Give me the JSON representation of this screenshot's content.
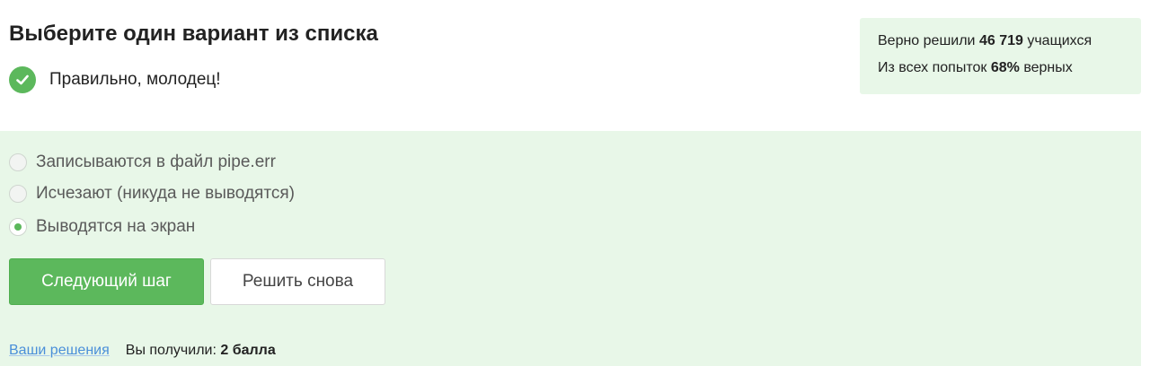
{
  "question": {
    "heading": "Выберите один вариант из списка",
    "feedback": "Правильно, молодец!"
  },
  "stats": {
    "solved_prefix": "Верно решили",
    "solved_count": "46 719",
    "solved_suffix": "учащихся",
    "attempts_prefix": "Из всех попыток",
    "attempts_percent": "68%",
    "attempts_suffix": "верных"
  },
  "options": [
    {
      "label": "Записываются в файл pipe.err",
      "selected": false
    },
    {
      "label": "Исчезают (никуда не выводятся)",
      "selected": false
    },
    {
      "label": "Выводятся на экран",
      "selected": true
    }
  ],
  "buttons": {
    "next": "Следующий шаг",
    "retry": "Решить снова"
  },
  "footer": {
    "solutions_link": "Ваши решения",
    "score_prefix": "Вы получили:",
    "score_value": "2 балла"
  },
  "colors": {
    "accent": "#5cb85c",
    "panel_bg": "#e8f7e8",
    "link": "#4a8fd9"
  }
}
